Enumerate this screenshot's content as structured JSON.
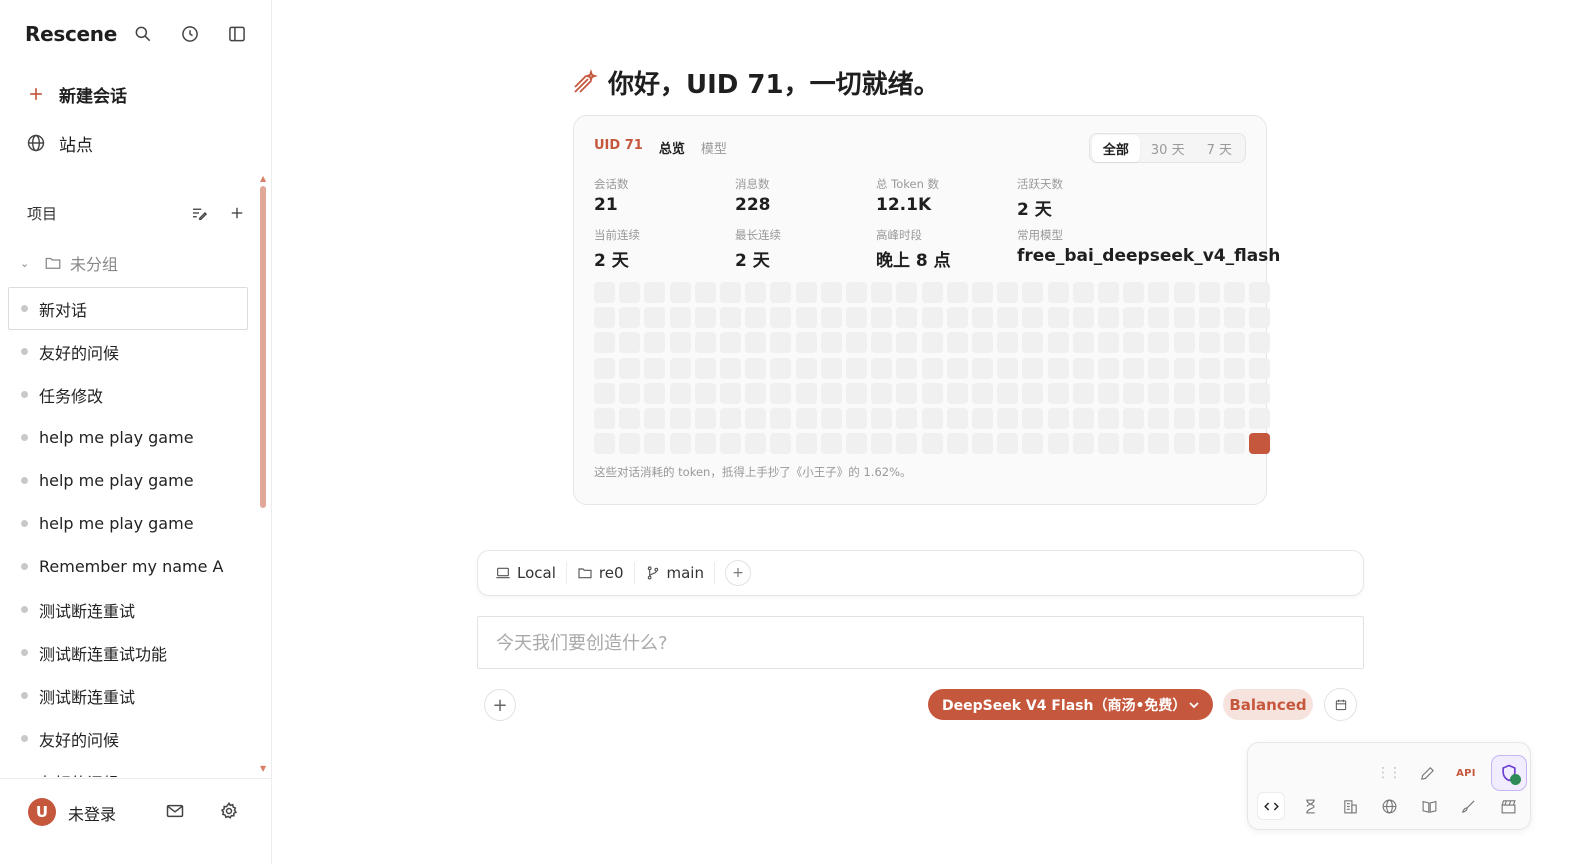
{
  "app": {
    "name": "Rescene"
  },
  "sidebar": {
    "new_chat": "新建会话",
    "sites": "站点",
    "projects_label": "项目",
    "group_label": "未分组",
    "conversations": [
      "新对话",
      "友好的问候",
      "任务修改",
      "help me play game",
      "help me play game",
      "help me play game",
      "Remember my name A",
      "测试断连重试",
      "测试断连重试功能",
      "测试断连重试",
      "友好的问候",
      "友好的问候"
    ],
    "active_index": 0,
    "footer": {
      "avatar_initial": "U",
      "login_text": "未登录"
    }
  },
  "main": {
    "greeting": "你好，UID 71，一切就绪。",
    "card": {
      "tabs": {
        "uid": "UID 71",
        "overview": "总览",
        "models": "模型"
      },
      "ranges": [
        "全部",
        "30 天",
        "7 天"
      ],
      "selected_range": 0,
      "stats": [
        {
          "label": "会话数",
          "value": "21"
        },
        {
          "label": "消息数",
          "value": "228"
        },
        {
          "label": "总 Token 数",
          "value": "12.1K"
        },
        {
          "label": "活跃天数",
          "value": "2 天"
        },
        {
          "label": "当前连续",
          "value": "2 天"
        },
        {
          "label": "最长连续",
          "value": "2 天"
        },
        {
          "label": "高峰时段",
          "value": "晚上 8 点"
        },
        {
          "label": "常用模型",
          "value": "free_bai_deepseek_v4_flash"
        }
      ],
      "heatmap": {
        "cols": 27,
        "rows": 7,
        "active_cells": [
          [
            26,
            6
          ]
        ]
      },
      "note": "这些对话消耗的 token，抵得上手抄了《小王子》的 1.62%。"
    },
    "context": {
      "location": "Local",
      "folder": "re0",
      "branch": "main",
      "add": "+"
    },
    "prompt": {
      "placeholder": "今天我们要创造什么?"
    },
    "controls": {
      "attach": "+",
      "model": "DeepSeek V4 Flash（商汤•免费）",
      "mode": "Balanced"
    },
    "tool_panel": {
      "api_label": "API"
    }
  },
  "colors": {
    "accent": "#c5573d",
    "accent_soft": "#f7e3dd",
    "heat_empty": "#f0f0f0",
    "shield_bg": "#f1ecff"
  }
}
